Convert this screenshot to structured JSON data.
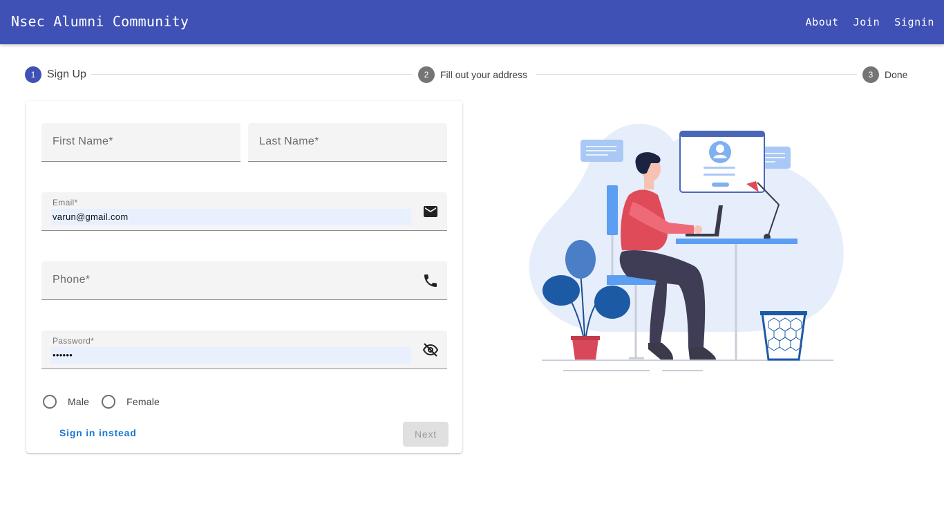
{
  "app": {
    "title": "Nsec Alumni Community"
  },
  "nav": {
    "items": [
      "About",
      "Join",
      "Signin"
    ]
  },
  "stepper": {
    "steps": [
      {
        "number": "1",
        "label": "Sign Up"
      },
      {
        "number": "2",
        "label": "Fill out your address"
      },
      {
        "number": "3",
        "label": "Done"
      }
    ],
    "active_step": 1
  },
  "form": {
    "first_name": {
      "placeholder": "First Name*"
    },
    "last_name": {
      "placeholder": "Last Name*"
    },
    "email": {
      "label": "Email*",
      "value": "varun@gmail.com",
      "icon": "mail-icon"
    },
    "phone": {
      "placeholder": "Phone*",
      "icon": "phone-icon"
    },
    "password": {
      "label": "Password*",
      "value": "••••••",
      "icon": "visibility-off-icon"
    },
    "gender_options": [
      "Male",
      "Female"
    ],
    "sign_in_instead": "Sign in instead",
    "next": "Next"
  },
  "colors": {
    "primary": "#3f51b5",
    "link": "#1976d2",
    "field_bg": "#f4f4f4",
    "autofill_bg": "#e8f0fe"
  }
}
